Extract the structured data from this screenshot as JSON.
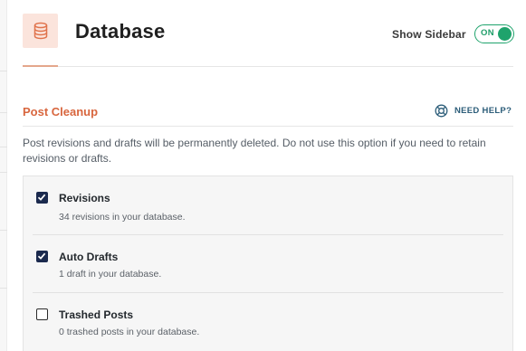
{
  "header": {
    "icon": "database-icon",
    "title": "Database",
    "sidebar_toggle_label": "Show Sidebar",
    "sidebar_toggle_state": "ON"
  },
  "section": {
    "title": "Post Cleanup",
    "help_label": "NEED HELP?",
    "help_icon": "lifebuoy-icon",
    "description": "Post revisions and drafts will be permanently deleted. Do not use this option if you need to retain revisions or drafts."
  },
  "options": [
    {
      "label": "Revisions",
      "detail": "34 revisions in your database.",
      "checked": true
    },
    {
      "label": "Auto Drafts",
      "detail": "1 draft in your database.",
      "checked": true
    },
    {
      "label": "Trashed Posts",
      "detail": "0 trashed posts in your database.",
      "checked": false
    }
  ],
  "colors": {
    "accent": "#d8663e",
    "toggle_on": "#1fa36c",
    "checkbox_checked": "#1b2a4e",
    "help_link": "#2c5d79"
  }
}
